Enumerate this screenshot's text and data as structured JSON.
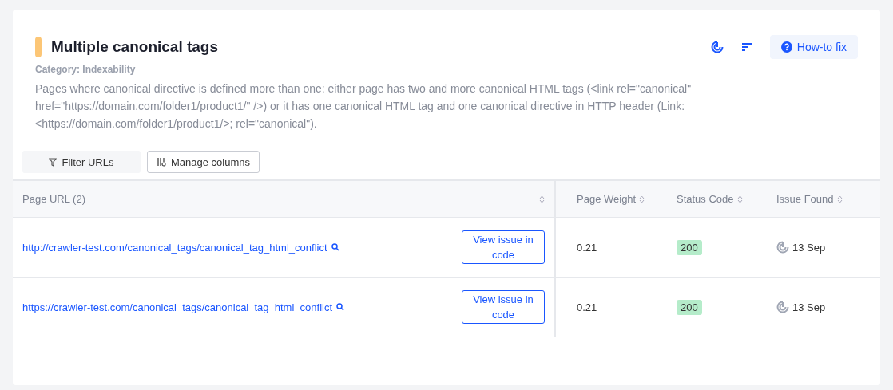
{
  "issue": {
    "title": "Multiple canonical tags",
    "category": "Category: Indexability",
    "description": "Pages where canonical directive is defined more than one: either page has two and more canonical HTML tags (<link rel=\"canonical\" href=\"https://domain.com/folder1/product1/\" />) or it has one canonical HTML tag and one canonical directive in HTTP header (Link: <https://domain.com/folder1/product1/>; rel=\"canonical\").",
    "how_to_fix": "How-to fix"
  },
  "toolbar": {
    "filter": "Filter URLs",
    "manage": "Manage columns"
  },
  "table": {
    "columns": [
      "Page URL (2)",
      "Page Weight",
      "Status Code",
      "Issue Found"
    ],
    "rows": [
      {
        "url": "http://crawler-test.com/canonical_tags/canonical_tag_html_conflict",
        "action": "View issue in code",
        "weight": "0.21",
        "status": "200",
        "found": "13 Sep"
      },
      {
        "url": "https://crawler-test.com/canonical_tags/canonical_tag_html_conflict",
        "action": "View issue in code",
        "weight": "0.21",
        "status": "200",
        "found": "13 Sep"
      }
    ]
  }
}
